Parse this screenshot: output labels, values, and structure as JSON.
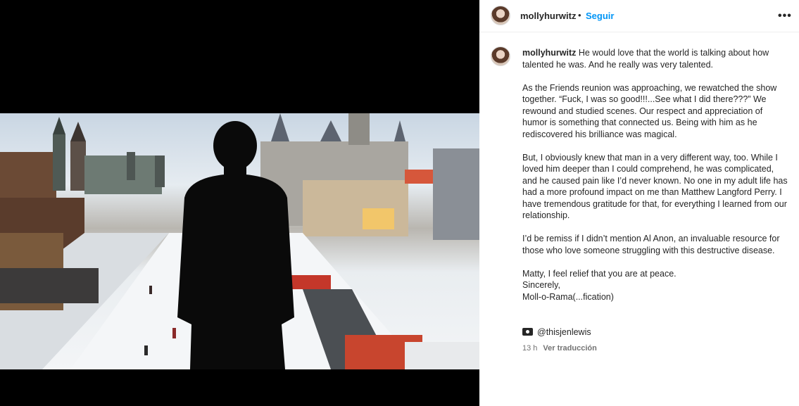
{
  "header": {
    "username": "mollyhurwitz",
    "dot": "•",
    "follow_label": "Seguir",
    "more_icon": "more-horizontal-icon"
  },
  "caption": {
    "username": "mollyhurwitz",
    "paragraphs": [
      "He would love that the world is talking about how talented he was. And he really was very talented.",
      "As the Friends reunion was approaching, we rewatched the show together. “Fuck, I was so good!!!...See what I did there???” We rewound and studied scenes. Our respect and appreciation of humor is something that connected us. Being with him as he rediscovered his brilliance was magical.",
      "But, I obviously knew that man in a very different way, too. While I loved him deeper than I could comprehend, he was complicated, and he caused pain like I’d never known. No one in my adult life has had a more profound impact on me than Matthew Langford Perry. I have tremendous gratitude for that, for everything I learned from our relationship.",
      "I’d be remiss if I didn’t mention Al Anon, an invaluable resource for those who love someone struggling with this destructive disease."
    ],
    "closing": [
      "Matty, I feel relief that you are at peace.",
      "Sincerely,",
      "Moll-o-Rama(...fication)"
    ]
  },
  "credit": {
    "icon": "camera-icon",
    "handle": "@thisjenlewis"
  },
  "meta": {
    "time": "13 h",
    "translate_label": "Ver traducción"
  },
  "colors": {
    "link": "#0095f6",
    "text": "#262626",
    "muted": "#737373"
  }
}
